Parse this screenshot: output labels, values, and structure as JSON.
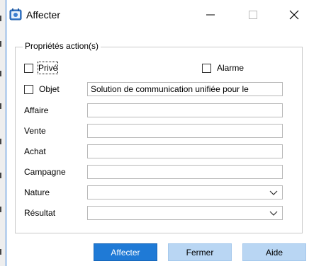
{
  "window": {
    "title": "Affecter",
    "app_icon": "app-icon",
    "controls": {
      "minimize": "minimize-icon",
      "maximize": "maximize-icon",
      "close": "close-icon"
    }
  },
  "group": {
    "legend": "Propriétés action(s)",
    "prive_label": "Privé",
    "prive_checked": false,
    "alarme_label": "Alarme",
    "alarme_checked": false,
    "objet_label": "Objet",
    "objet_checked": false,
    "objet_value": "Solution de communication unifiée pour le",
    "fields": {
      "affaire_label": "Affaire",
      "affaire_value": "",
      "vente_label": "Vente",
      "vente_value": "",
      "achat_label": "Achat",
      "achat_value": "",
      "campagne_label": "Campagne",
      "campagne_value": "",
      "nature_label": "Nature",
      "nature_value": "",
      "resultat_label": "Résultat",
      "resultat_value": ""
    }
  },
  "buttons": {
    "affecter": "Affecter",
    "fermer": "Fermer",
    "aide": "Aide"
  },
  "colors": {
    "primary_button": "#1f7ad6",
    "secondary_button": "#b9d6f3",
    "window_border": "#2b78d6"
  }
}
